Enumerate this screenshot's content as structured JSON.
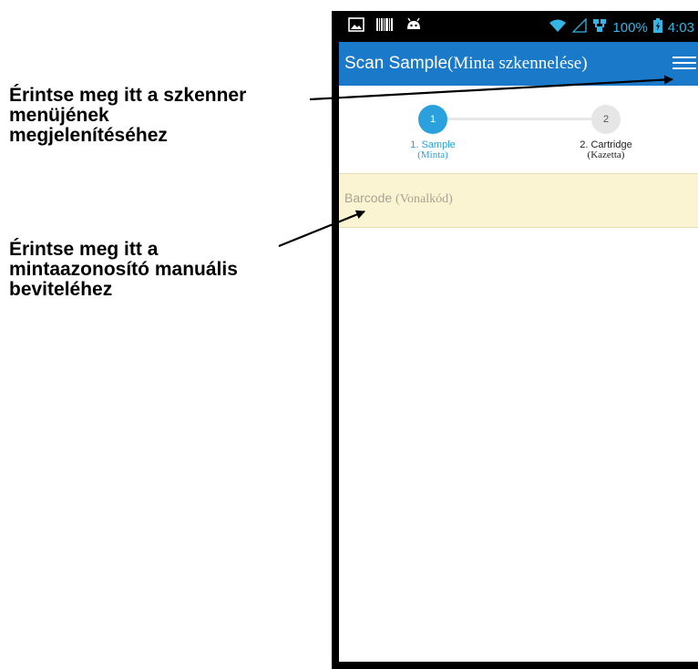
{
  "callouts": {
    "menu": {
      "lines": [
        "Érintse meg itt a szkenner",
        "menüjének",
        "megjelenítéséhez"
      ]
    },
    "barcode": {
      "lines": [
        "Érintse meg itt a",
        "mintaazonosító manuális",
        "beviteléhez"
      ]
    }
  },
  "status_bar": {
    "left_icons": [
      "gallery-icon",
      "barcode-icon",
      "android-icon"
    ],
    "right_icons": [
      "wifi-icon",
      "signal-icon",
      "network-icon",
      "battery-charging-icon"
    ],
    "battery": "100%",
    "time": "4:03"
  },
  "app_bar": {
    "title": "Scan Sample",
    "title_translation": "(Minta szkennelése)",
    "menu_icon": "hamburger-menu-icon"
  },
  "stepper": {
    "steps": [
      {
        "number": "1",
        "label": "1. Sample",
        "translation": "(Minta)",
        "state": "active"
      },
      {
        "number": "2",
        "label": "2. Cartridge",
        "translation": "(Kazetta)",
        "state": "inactive"
      }
    ]
  },
  "barcode_field": {
    "placeholder": "Barcode",
    "placeholder_translation": "(Vonalkód)"
  },
  "colors": {
    "app_bar": "#1a79c9",
    "step_active": "#2aa1dc",
    "step_inactive": "#e6e6e6",
    "barcode_bg": "#faf4d2",
    "status_accent": "#33b5e5"
  }
}
